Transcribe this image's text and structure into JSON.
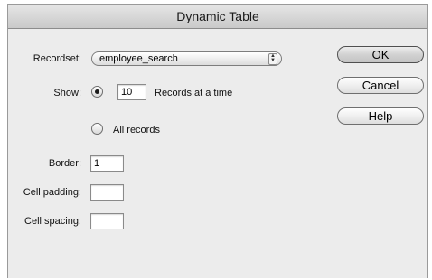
{
  "dialog": {
    "title": "Dynamic Table"
  },
  "recordset": {
    "label": "Recordset:",
    "value": "employee_search",
    "arrows_icon": "up-down-arrows-icon"
  },
  "show": {
    "label": "Show:",
    "records_value": "10",
    "records_suffix": "Records at a time",
    "all_records_label": "All records",
    "selected": "records-at-a-time"
  },
  "border": {
    "label": "Border:",
    "value": "1"
  },
  "cell_padding": {
    "label": "Cell padding:",
    "value": ""
  },
  "cell_spacing": {
    "label": "Cell spacing:",
    "value": ""
  },
  "buttons": {
    "ok": "OK",
    "cancel": "Cancel",
    "help": "Help"
  }
}
